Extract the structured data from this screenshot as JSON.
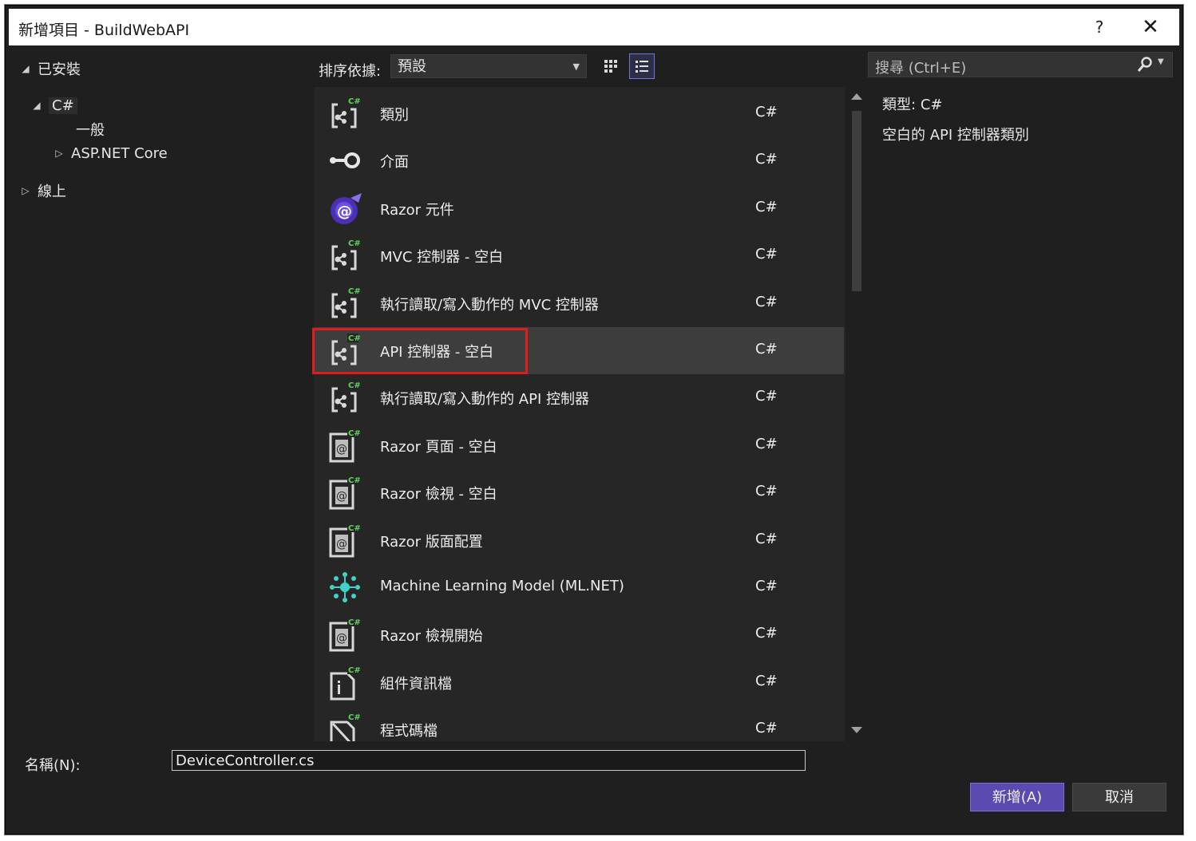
{
  "window": {
    "title": "新增項目 - BuildWebAPI",
    "help_glyph": "?",
    "close_glyph": "✕"
  },
  "tree": {
    "installed": "已安裝",
    "csharp": "C#",
    "general": "一般",
    "aspnet": "ASP.NET Core",
    "online": "線上"
  },
  "sort": {
    "label": "排序依據:",
    "value": "預設"
  },
  "search": {
    "placeholder": "搜尋 (Ctrl+E)"
  },
  "templates": [
    {
      "name": "類別",
      "lang": "C#",
      "icon": "class-icon"
    },
    {
      "name": "介面",
      "lang": "C#",
      "icon": "interface-icon"
    },
    {
      "name": "Razor 元件",
      "lang": "C#",
      "icon": "blazor-icon"
    },
    {
      "name": "MVC 控制器 - 空白",
      "lang": "C#",
      "icon": "controller-icon"
    },
    {
      "name": "執行讀取/寫入動作的 MVC 控制器",
      "lang": "C#",
      "icon": "controller-icon"
    },
    {
      "name": "API 控制器 - 空白",
      "lang": "C#",
      "icon": "controller-icon"
    },
    {
      "name": "執行讀取/寫入動作的 API 控制器",
      "lang": "C#",
      "icon": "controller-icon"
    },
    {
      "name": "Razor 頁面 - 空白",
      "lang": "C#",
      "icon": "razor-page-icon"
    },
    {
      "name": "Razor 檢視 - 空白",
      "lang": "C#",
      "icon": "razor-page-icon"
    },
    {
      "name": "Razor 版面配置",
      "lang": "C#",
      "icon": "razor-page-icon"
    },
    {
      "name": "Machine Learning Model (ML.NET)",
      "lang": "C#",
      "icon": "mlnet-icon"
    },
    {
      "name": "Razor 檢視開始",
      "lang": "C#",
      "icon": "razor-page-icon"
    },
    {
      "name": "組件資訊檔",
      "lang": "C#",
      "icon": "assembly-info-icon"
    },
    {
      "name": "程式碼檔",
      "lang": "C#",
      "icon": "code-file-icon"
    }
  ],
  "selected_index": 5,
  "details": {
    "type_label": "類型:",
    "type_value": "C#",
    "description": "空白的 API 控制器類別"
  },
  "name_field": {
    "label": "名稱(N):",
    "value": "DeviceController.cs"
  },
  "buttons": {
    "add": "新增(A)",
    "cancel": "取消"
  },
  "colors": {
    "accent": "#5b4ab0",
    "highlight_box": "#e21b1b",
    "csharp_badge": "#5fd35f",
    "mlnet": "#3fd2c7",
    "blazor": "#6b4fe0"
  }
}
